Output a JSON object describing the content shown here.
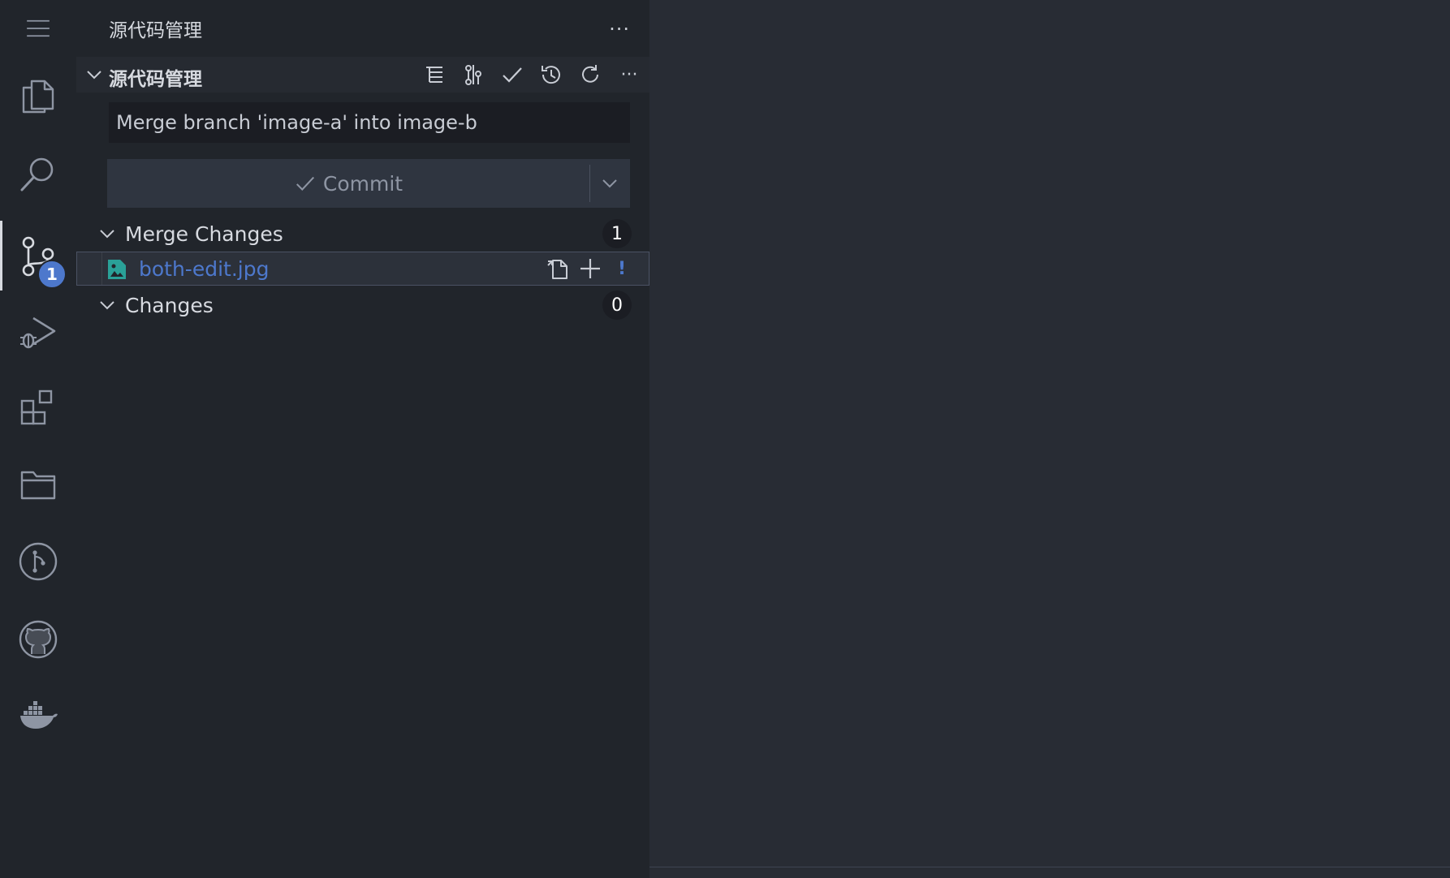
{
  "activity_bar": {
    "items": [
      {
        "name": "explorer-icon"
      },
      {
        "name": "search-icon"
      },
      {
        "name": "source-control-icon",
        "badge": "1"
      },
      {
        "name": "run-debug-icon"
      },
      {
        "name": "extensions-icon"
      },
      {
        "name": "folder-icon"
      },
      {
        "name": "git-graph-icon"
      },
      {
        "name": "github-icon"
      },
      {
        "name": "docker-icon"
      }
    ]
  },
  "sidebar": {
    "title": "源代码管理",
    "section_title": "源代码管理",
    "commit_message": "Merge branch 'image-a' into image-b",
    "commit_label": "Commit",
    "groups": [
      {
        "label": "Merge Changes",
        "count": "1"
      },
      {
        "label": "Changes",
        "count": "0"
      }
    ],
    "files": [
      {
        "name": "both-edit.jpg",
        "status": "!"
      }
    ]
  },
  "colors": {
    "accent": "#4d78cc",
    "sidebar_bg": "#21252b",
    "editor_bg": "#282c34"
  }
}
